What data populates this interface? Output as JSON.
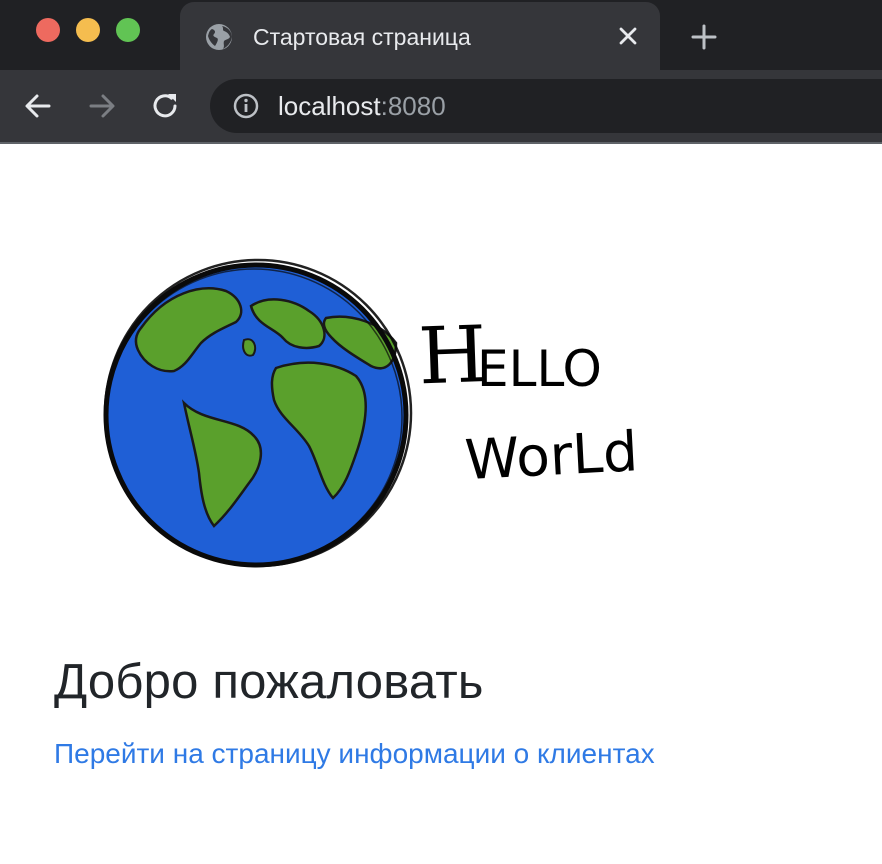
{
  "window": {
    "controls": [
      "close",
      "minimize",
      "maximize"
    ]
  },
  "tab": {
    "title": "Стартовая страница",
    "icon": "globe-icon"
  },
  "toolbar": {
    "back_icon": "back-arrow-icon",
    "forward_icon": "forward-arrow-icon",
    "reload_icon": "reload-icon",
    "url_host": "localhost",
    "url_port": ":8080"
  },
  "page": {
    "image_caption_text": "Hello World!",
    "heading": "Добро пожаловать",
    "link": "Перейти на страницу информации о клиентах"
  },
  "colors": {
    "link": "#2f7ae5",
    "heading": "#212529",
    "ocean": "#1f5fd6",
    "land": "#5aa02c"
  }
}
